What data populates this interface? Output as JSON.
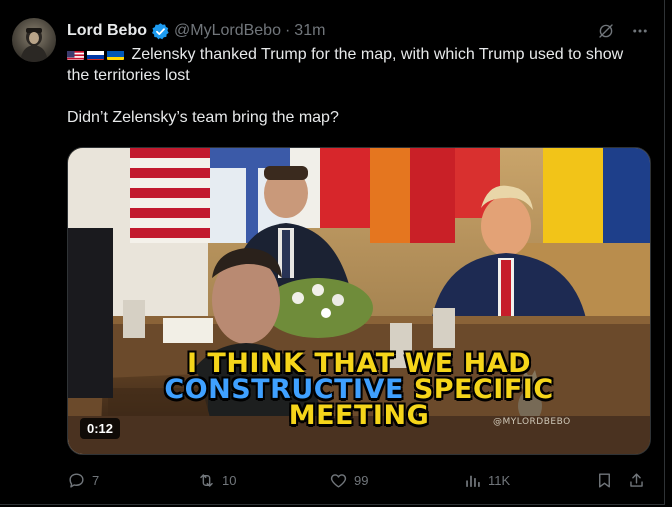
{
  "post": {
    "display_name": "Lord Bebo",
    "handle": "@MyLordBebo",
    "separator": "·",
    "time": "31m",
    "flags": [
      "us-flag",
      "russia-flag",
      "ukraine-flag"
    ],
    "text_line1": "Zelensky thanked Trump for the map, with which Trump used to show the territories lost",
    "text_line2": "Didn’t Zelensky’s team bring the map?"
  },
  "media": {
    "caption_line1": "I THINK THAT WE HAD",
    "caption_line2_a": "CONSTRUCTIVE",
    "caption_line2_b": "SPECIFIC",
    "caption_line3": "MEETING",
    "watermark": "@MYLORDBEBO",
    "duration": "0:12"
  },
  "actions": {
    "replies": "7",
    "reposts": "10",
    "likes": "99",
    "views": "11K"
  },
  "colors": {
    "background": "#000000",
    "text": "#e7e9ea",
    "muted": "#71767b",
    "verified": "#1d9bf0",
    "caption_yellow": "#f5d51a",
    "caption_blue": "#3fa0ff"
  }
}
